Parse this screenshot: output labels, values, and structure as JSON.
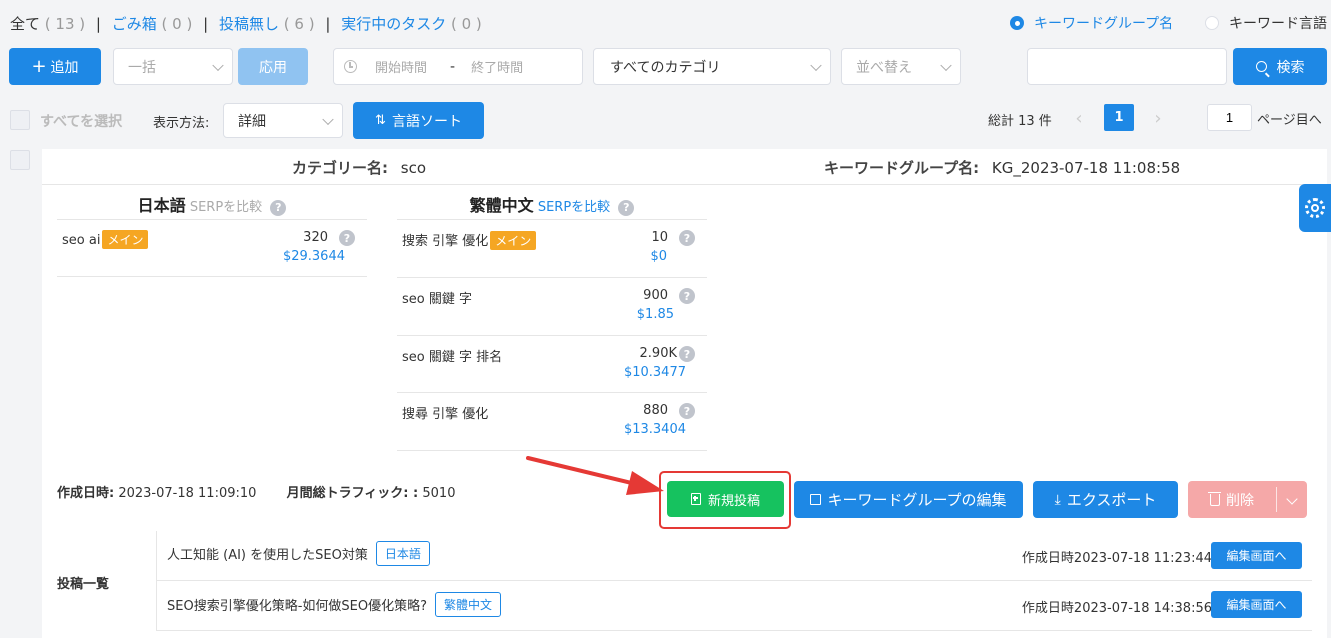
{
  "filters": {
    "all": "全て",
    "all_count": "( 13 )",
    "trash": "ごみ箱",
    "trash_count": "( 0 )",
    "no_post": "投稿無し",
    "no_post_count": "( 6 )",
    "running": "実行中のタスク",
    "running_count": "( 0 )",
    "separator": "|"
  },
  "search_mode": {
    "option1": "キーワードグループ名",
    "option2": "キーワード言語",
    "selected": "option1"
  },
  "toolbar": {
    "add_label": "追加",
    "bulk_placeholder": "一括",
    "apply_label": "応用",
    "start_time_placeholder": "開始時間",
    "date_separator": "-",
    "end_time_placeholder": "終了時間",
    "category_value": "すべてのカテゴリ",
    "sort_placeholder": "並べ替え",
    "search_value": "",
    "search_label": "検索"
  },
  "viewbar": {
    "select_all": "すべてを選択",
    "display_label": "表示方法:",
    "display_value": "詳細",
    "lang_sort_label": "言語ソート"
  },
  "pagination": {
    "total": "総計 13 件",
    "current_page": "1",
    "page_input": "1",
    "page_suffix": "ページ目へ",
    "prev": "‹",
    "next": "›"
  },
  "card": {
    "category_label": "カテゴリー名:",
    "category_value": "sco",
    "group_label": "キーワードグループ名:",
    "group_value": "KG_2023-07-18 11:08:58",
    "main_badge": "メイン",
    "q_mark": "?",
    "languages": [
      {
        "name": "日本語",
        "serp_label": "SERPを比較",
        "keywords": [
          {
            "name": "seo ai",
            "main": true,
            "volume": "320",
            "cpc": "$29.3644"
          }
        ]
      },
      {
        "name": "繁體中文",
        "serp_label": "SERPを比較",
        "keywords": [
          {
            "name": "搜索 引擎 優化",
            "main": true,
            "volume": "10",
            "cpc": "$0"
          },
          {
            "name": "seo 關鍵 字",
            "main": false,
            "volume": "900",
            "cpc": "$1.85"
          },
          {
            "name": "seo 關鍵 字 排名",
            "main": false,
            "volume": "2.90K",
            "cpc": "$10.3477"
          },
          {
            "name": "搜尋 引擎 優化",
            "main": false,
            "volume": "880",
            "cpc": "$13.3404"
          }
        ]
      }
    ],
    "created_label": "作成日時:",
    "created_value": "2023-07-18 11:09:10",
    "traffic_label": "月間総トラフィック: :",
    "traffic_value": "5010",
    "new_post_label": "新規投稿",
    "edit_group_label": "キーワードグループの編集",
    "export_label": "エクスポート",
    "delete_label": "削除",
    "posts_label": "投稿一覧",
    "posts": [
      {
        "title": "人工知能 (AI) を使用したSEO対策",
        "lang": "日本語",
        "created": "作成日時2023-07-18 11:23:44",
        "edit_label": "編集画面へ"
      },
      {
        "title": "SEO搜索引擎優化策略-如何做SEO優化策略?",
        "lang": "繁體中文",
        "created": "作成日時2023-07-18 14:38:56",
        "edit_label": "編集画面へ"
      }
    ]
  },
  "colors": {
    "primary": "#1e88e5",
    "success": "#16c25f",
    "danger_light": "#f5a8a8",
    "highlight": "#e53935",
    "badge": "#f5a623"
  }
}
